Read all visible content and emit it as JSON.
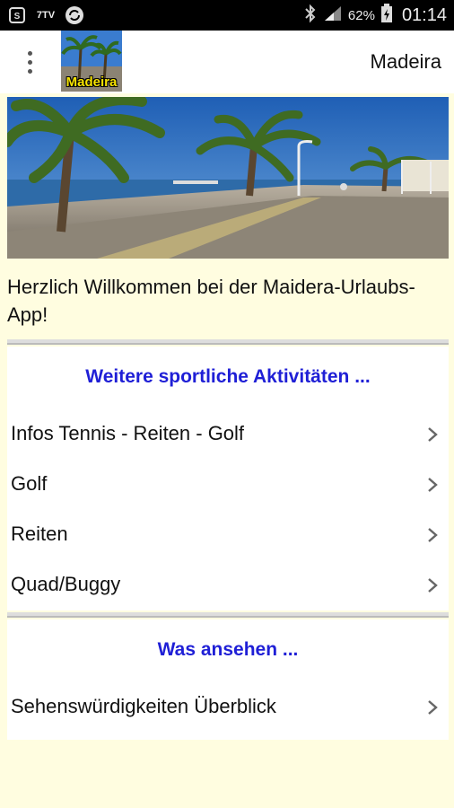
{
  "status_bar": {
    "icons": [
      "sim-icon",
      "tv-icon",
      "sync-icon"
    ],
    "tv_label": "7TV",
    "battery_percent": "62%",
    "time": "01:14"
  },
  "app_bar": {
    "logo_text": "Madeira",
    "title": "Madeira"
  },
  "welcome_text": "Herzlich Willkommen bei der Maidera-Urlaubs-App!",
  "sections": [
    {
      "title": "Weitere sportliche Aktivitäten ...",
      "items": [
        {
          "label": "Infos Tennis - Reiten - Golf"
        },
        {
          "label": "Golf"
        },
        {
          "label": "Reiten"
        },
        {
          "label": "Quad/Buggy"
        }
      ]
    },
    {
      "title": "Was ansehen ...",
      "items": [
        {
          "label": "Sehenswürdigkeiten Überblick"
        }
      ]
    }
  ],
  "colors": {
    "background": "#fffde0",
    "section_title": "#1f1fd6",
    "status_bar": "#000000"
  }
}
